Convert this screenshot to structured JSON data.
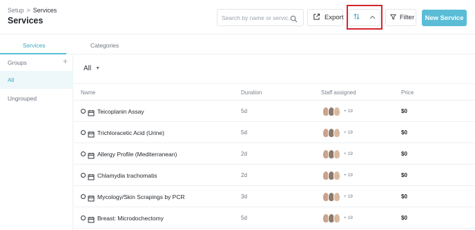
{
  "header": {
    "breadcrumb": {
      "root": "Setup",
      "separator": ">",
      "current": "Services"
    },
    "title": "Services",
    "search_placeholder": "Search by name or servic...",
    "export_label": "Export",
    "sort_icon": "sort-arrows-icon",
    "filter_label": "Filter",
    "new_button_label": "New Service",
    "accent_color": "#5bbcd6",
    "highlight_color": "#d5232b"
  },
  "tabs": [
    {
      "label": "Services",
      "active": true
    },
    {
      "label": "Categories",
      "active": false
    }
  ],
  "sidebar": {
    "heading": "Groups",
    "add_label": "+",
    "items": [
      {
        "label": "All",
        "active": true
      },
      {
        "label": "Ungrouped",
        "active": false
      }
    ]
  },
  "main": {
    "group_select": "All",
    "columns": {
      "name": "Name",
      "duration": "Duration",
      "staff": "Staff assigned",
      "price": "Price"
    },
    "rows": [
      {
        "name": "Teicoplanin Assay",
        "duration": "5d",
        "staff_more": "+ 19",
        "price": "$0"
      },
      {
        "name": "Trichloracetic Acid (Urine)",
        "duration": "5d",
        "staff_more": "+ 19",
        "price": "$0"
      },
      {
        "name": "Allergy Profile (Mediterranean)",
        "duration": "2d",
        "staff_more": "+ 19",
        "price": "$0"
      },
      {
        "name": "Chlamydia trachomatis",
        "duration": "2d",
        "staff_more": "+ 19",
        "price": "$0"
      },
      {
        "name": "Mycology/Skin Scrapings by PCR",
        "duration": "3d",
        "staff_more": "+ 19",
        "price": "$0"
      },
      {
        "name": "Breast: Microdochectomy",
        "duration": "5d",
        "staff_more": "+ 19",
        "price": "$0"
      }
    ]
  }
}
